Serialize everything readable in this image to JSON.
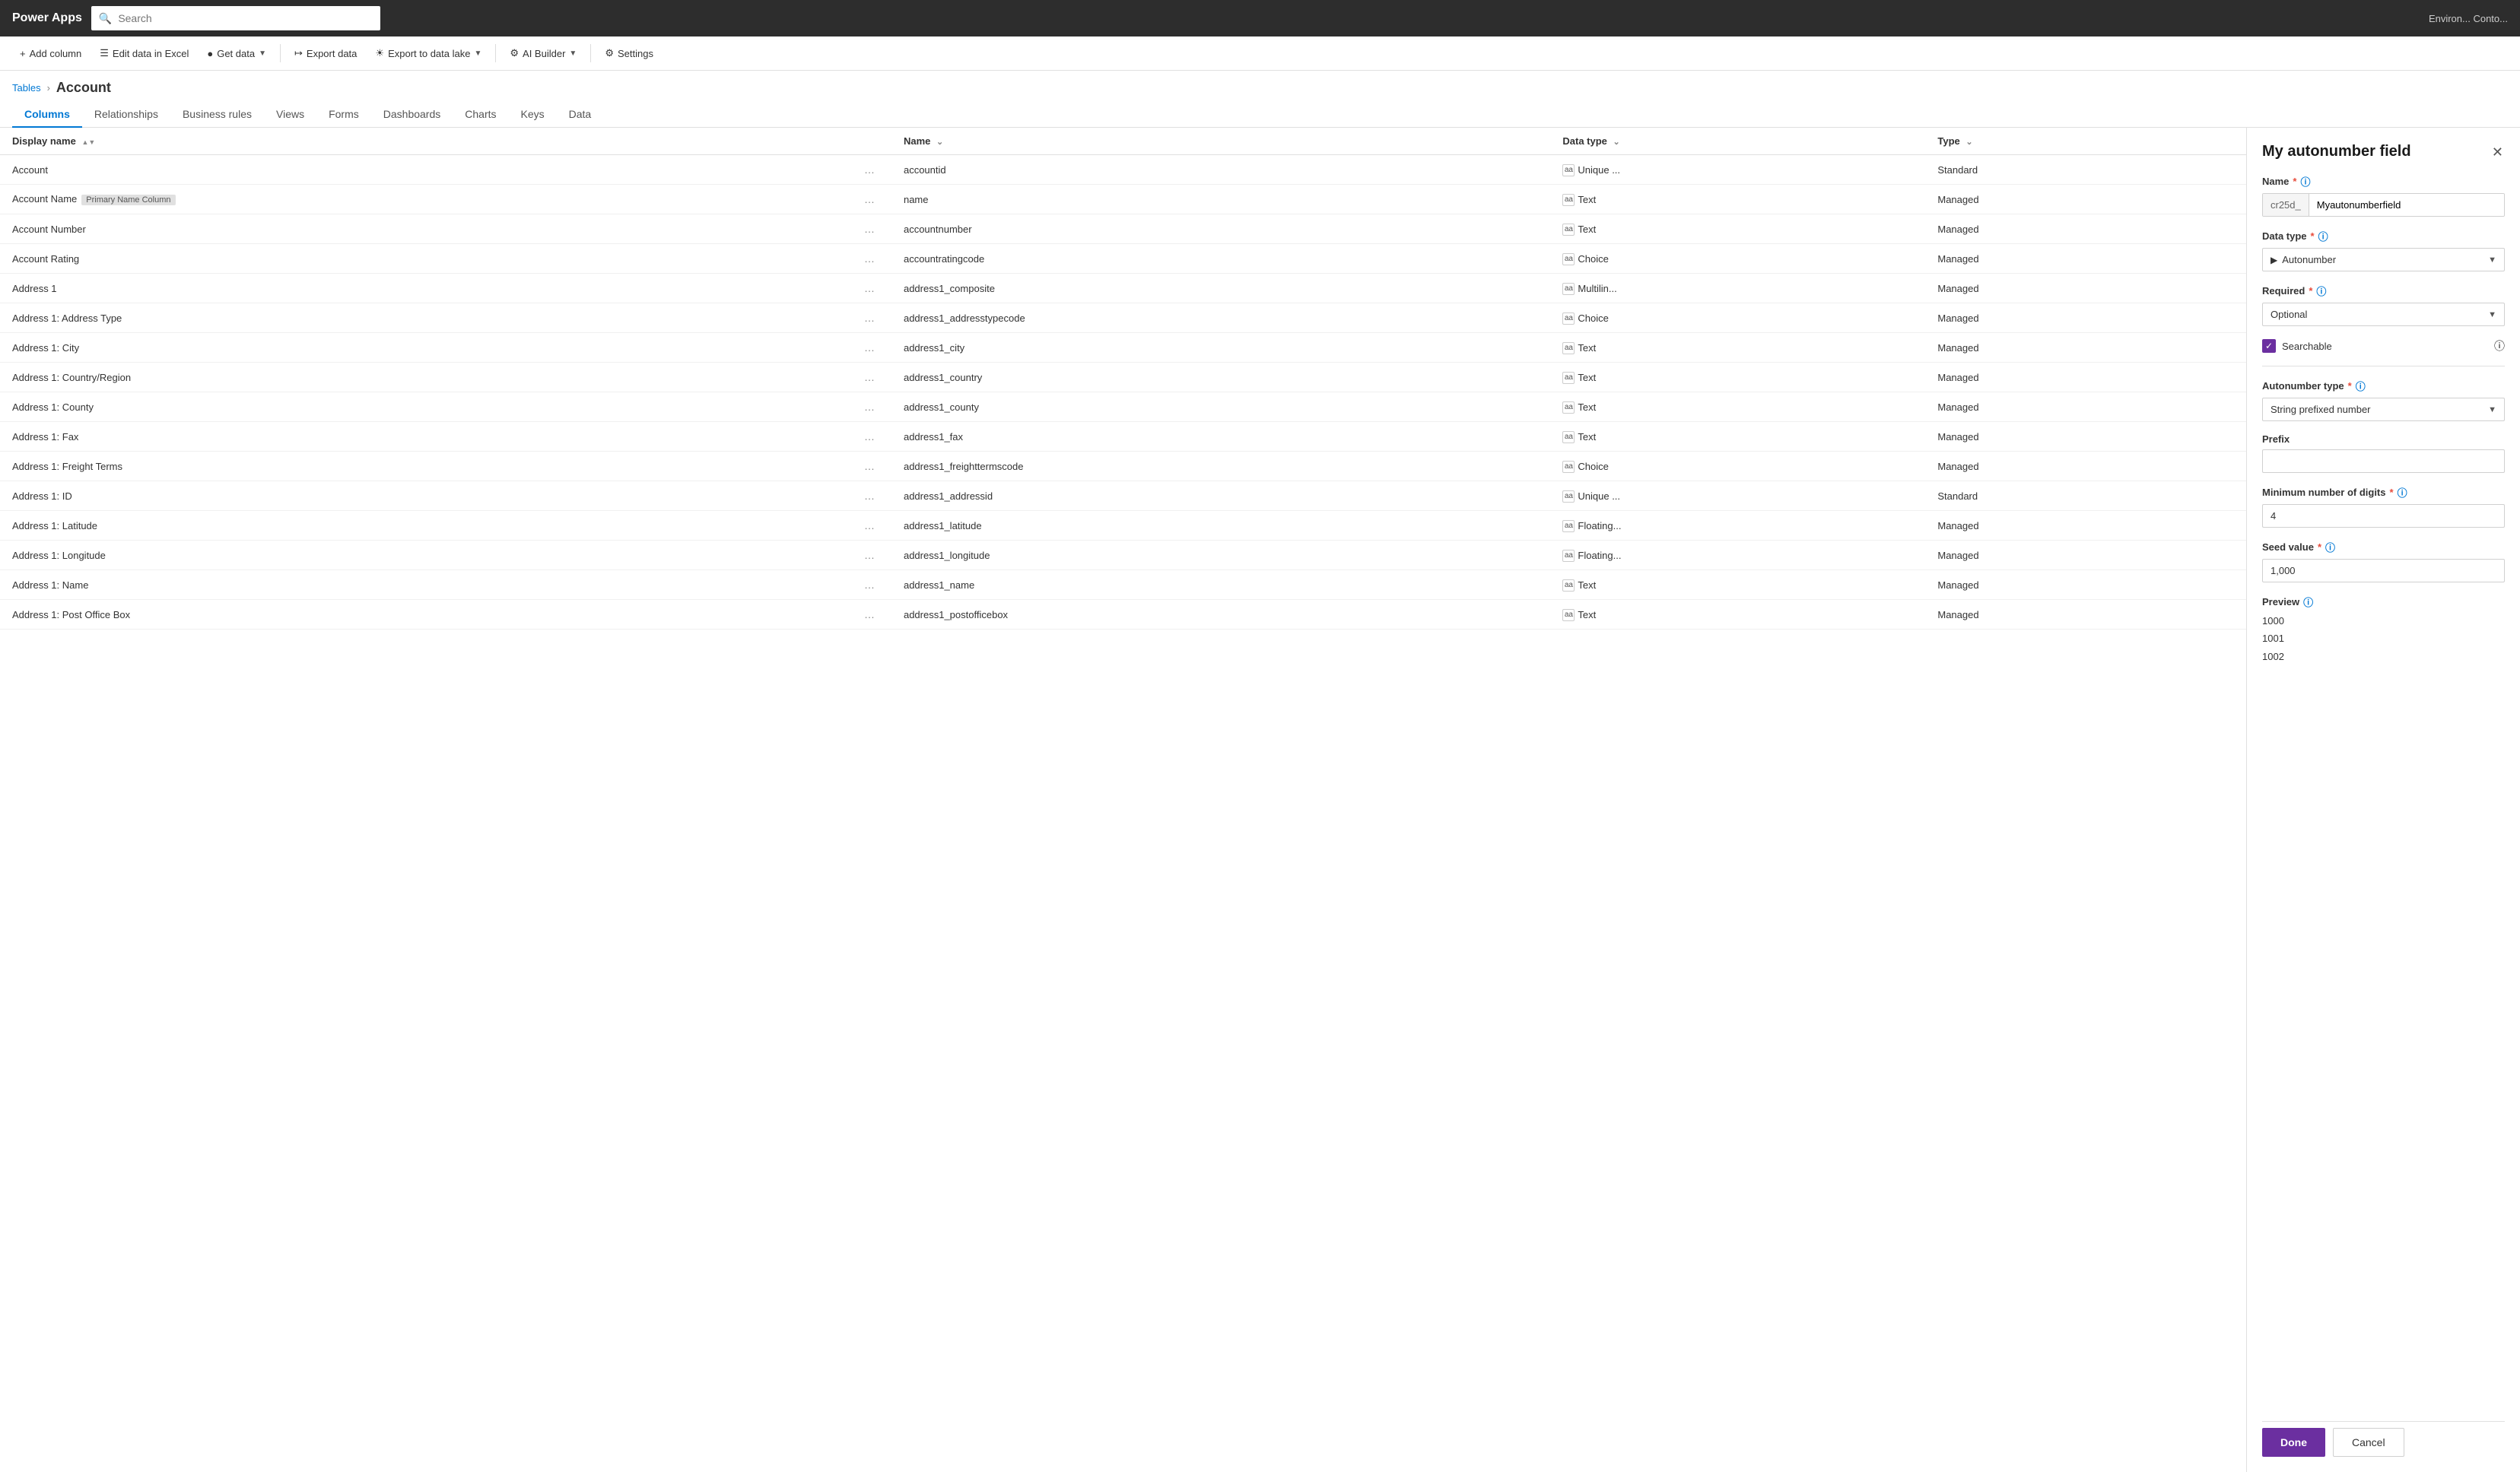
{
  "topbar": {
    "brand": "Power Apps",
    "search_placeholder": "Search",
    "env_label": "Environ... Conto..."
  },
  "toolbar": {
    "add_column": "Add column",
    "edit_excel": "Edit data in Excel",
    "get_data": "Get data",
    "export_data": "Export data",
    "export_lake": "Export to data lake",
    "ai_builder": "AI Builder",
    "settings": "Settings"
  },
  "breadcrumb": {
    "tables": "Tables",
    "arrow": "›",
    "current": "Account"
  },
  "nav_tabs": [
    {
      "label": "Columns",
      "active": true
    },
    {
      "label": "Relationships",
      "active": false
    },
    {
      "label": "Business rules",
      "active": false
    },
    {
      "label": "Views",
      "active": false
    },
    {
      "label": "Forms",
      "active": false
    },
    {
      "label": "Dashboards",
      "active": false
    },
    {
      "label": "Charts",
      "active": false
    },
    {
      "label": "Keys",
      "active": false
    },
    {
      "label": "Data",
      "active": false
    }
  ],
  "table": {
    "headers": [
      {
        "label": "Display name",
        "sortable": true
      },
      {
        "label": ""
      },
      {
        "label": "Name",
        "filterable": true
      },
      {
        "label": "Data type",
        "filterable": true
      },
      {
        "label": "Type",
        "filterable": true
      },
      {
        "label": ""
      }
    ],
    "rows": [
      {
        "display_name": "Account",
        "badge": "",
        "name": "accountid",
        "data_type": "Unique ...",
        "type": "Standard",
        "dt_icon": "🔑"
      },
      {
        "display_name": "Account Name",
        "badge": "Primary Name Column",
        "name": "name",
        "data_type": "Text",
        "type": "Managed",
        "dt_icon": "🔤"
      },
      {
        "display_name": "Account Number",
        "badge": "",
        "name": "accountnumber",
        "data_type": "Text",
        "type": "Managed",
        "dt_icon": "🔤"
      },
      {
        "display_name": "Account Rating",
        "badge": "",
        "name": "accountratingcode",
        "data_type": "Choice",
        "type": "Managed",
        "dt_icon": "☰"
      },
      {
        "display_name": "Address 1",
        "badge": "",
        "name": "address1_composite",
        "data_type": "Multilin...",
        "type": "Managed",
        "dt_icon": "🔤"
      },
      {
        "display_name": "Address 1: Address Type",
        "badge": "",
        "name": "address1_addresstypecode",
        "data_type": "Choice",
        "type": "Managed",
        "dt_icon": "☰"
      },
      {
        "display_name": "Address 1: City",
        "badge": "",
        "name": "address1_city",
        "data_type": "Text",
        "type": "Managed",
        "dt_icon": "🔤"
      },
      {
        "display_name": "Address 1: Country/Region",
        "badge": "",
        "name": "address1_country",
        "data_type": "Text",
        "type": "Managed",
        "dt_icon": "🔤"
      },
      {
        "display_name": "Address 1: County",
        "badge": "",
        "name": "address1_county",
        "data_type": "Text",
        "type": "Managed",
        "dt_icon": "🔤"
      },
      {
        "display_name": "Address 1: Fax",
        "badge": "",
        "name": "address1_fax",
        "data_type": "Text",
        "type": "Managed",
        "dt_icon": "🔤"
      },
      {
        "display_name": "Address 1: Freight Terms",
        "badge": "",
        "name": "address1_freighttermscode",
        "data_type": "Choice",
        "type": "Managed",
        "dt_icon": "☰"
      },
      {
        "display_name": "Address 1: ID",
        "badge": "",
        "name": "address1_addressid",
        "data_type": "Unique ...",
        "type": "Standard",
        "dt_icon": "🔑"
      },
      {
        "display_name": "Address 1: Latitude",
        "badge": "",
        "name": "address1_latitude",
        "data_type": "Floating...",
        "type": "Managed",
        "dt_icon": "🔢"
      },
      {
        "display_name": "Address 1: Longitude",
        "badge": "",
        "name": "address1_longitude",
        "data_type": "Floating...",
        "type": "Managed",
        "dt_icon": "🔢"
      },
      {
        "display_name": "Address 1: Name",
        "badge": "",
        "name": "address1_name",
        "data_type": "Text",
        "type": "Managed",
        "dt_icon": "🔤"
      },
      {
        "display_name": "Address 1: Post Office Box",
        "badge": "",
        "name": "address1_postofficebox",
        "data_type": "Text",
        "type": "Managed",
        "dt_icon": "🔤"
      }
    ]
  },
  "panel": {
    "title": "My autonumber field",
    "name_label": "Name",
    "name_required": "*",
    "name_prefix": "cr25d_",
    "name_value": "Myautonumberfield",
    "data_type_label": "Data type",
    "data_type_required": "*",
    "data_type_value": "Autonumber",
    "required_label": "Required",
    "required_required": "*",
    "required_value": "Optional",
    "searchable_label": "Searchable",
    "searchable_checked": true,
    "autonumber_type_label": "Autonumber type",
    "autonumber_type_required": "*",
    "autonumber_type_value": "String prefixed number",
    "prefix_label": "Prefix",
    "prefix_value": "",
    "min_digits_label": "Minimum number of digits",
    "min_digits_required": "*",
    "min_digits_value": "4",
    "seed_label": "Seed value",
    "seed_required": "*",
    "seed_value": "1,000",
    "preview_label": "Preview",
    "preview_values": [
      "1000",
      "1001",
      "1002"
    ],
    "done_label": "Done",
    "cancel_label": "Cancel"
  }
}
